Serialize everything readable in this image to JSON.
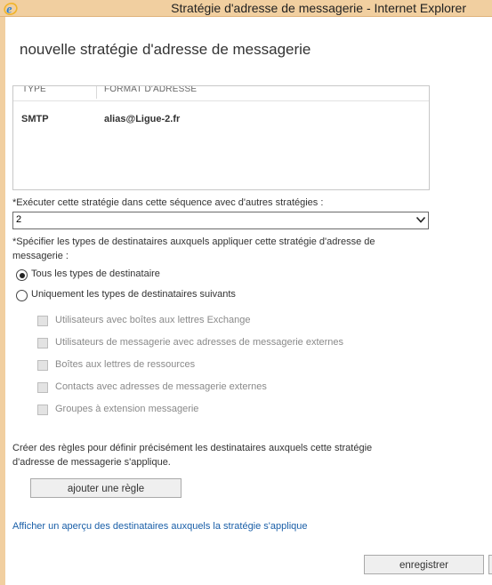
{
  "window": {
    "title": "Stratégie d'adresse de messagerie - Internet Explorer"
  },
  "dialog": {
    "title": "nouvelle stratégie d'adresse de messagerie"
  },
  "table": {
    "columns": [
      "TYPE",
      "FORMAT D'ADRESSE"
    ],
    "rows": [
      {
        "type": "SMTP",
        "format": "alias@Ligue-2.fr"
      }
    ]
  },
  "sequence": {
    "label": "*Exécuter cette stratégie dans cette séquence avec d'autres stratégies :",
    "selected": "2"
  },
  "recipients": {
    "label_line1": "*Spécifier les types de destinataires auxquels appliquer cette stratégie d'adresse de",
    "label_line2": "messagerie :",
    "option_all": "Tous les types de destinataire",
    "option_specific": "Uniquement les types de destinataires suivants",
    "selected_option": "all",
    "types": [
      {
        "label": "Utilisateurs avec boîtes aux lettres Exchange",
        "checked": false,
        "enabled": false
      },
      {
        "label": "Utilisateurs de messagerie avec adresses de messagerie externes",
        "checked": false,
        "enabled": false
      },
      {
        "label": "Boîtes aux lettres de ressources",
        "checked": false,
        "enabled": false
      },
      {
        "label": "Contacts avec adresses de messagerie externes",
        "checked": false,
        "enabled": false
      },
      {
        "label": "Groupes à extension messagerie",
        "checked": false,
        "enabled": false
      }
    ]
  },
  "rules": {
    "description_line1": "Créer des règles pour définir précisément les destinataires auxquels cette stratégie",
    "description_line2": "d'adresse de messagerie s'applique.",
    "add_button": "ajouter une règle"
  },
  "preview_link": "Afficher un aperçu des destinataires auxquels la stratégie s'applique",
  "footer": {
    "save_button": "enregistrer"
  },
  "colors": {
    "title_bar": "#f1cfa0",
    "link": "#1a5fa8",
    "ie_blue": "#2b7fd3",
    "ie_gold": "#f0b429"
  }
}
